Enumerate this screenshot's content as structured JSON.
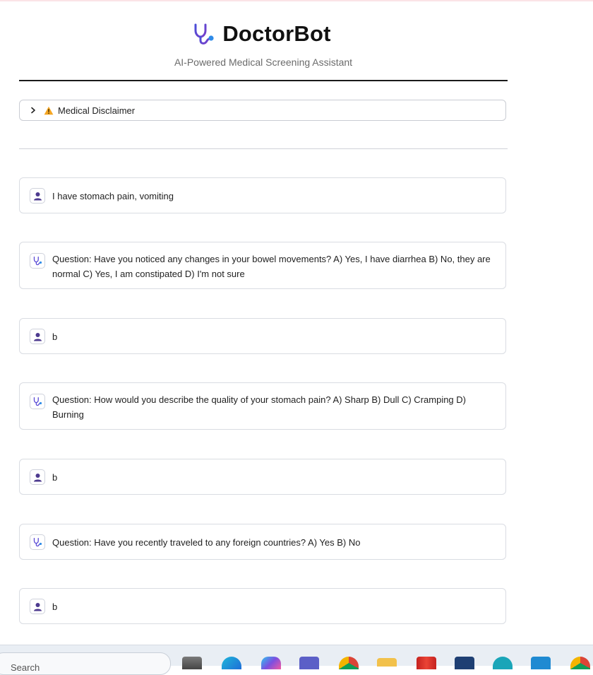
{
  "header": {
    "title": "DoctorBot",
    "subtitle": "AI-Powered Medical Screening Assistant",
    "logo_icon": "stethoscope-icon",
    "accent_color": "#5b4bd6"
  },
  "disclaimer": {
    "label": "Medical Disclaimer",
    "expand_icon": "chevron-right-icon",
    "warning_icon": "warning-icon"
  },
  "messages": [
    {
      "role": "user",
      "icon": "user-icon",
      "text": "I have stomach pain, vomiting"
    },
    {
      "role": "assistant",
      "icon": "stethoscope-icon",
      "text": "Question: Have you noticed any changes in your bowel movements? A) Yes, I have diarrhea B) No, they are normal C) Yes, I am constipated D) I'm not sure"
    },
    {
      "role": "user",
      "icon": "user-icon",
      "text": "b"
    },
    {
      "role": "assistant",
      "icon": "stethoscope-icon",
      "text": "Question: How would you describe the quality of your stomach pain? A) Sharp B) Dull C) Cramping D) Burning"
    },
    {
      "role": "user",
      "icon": "user-icon",
      "text": "b"
    },
    {
      "role": "assistant",
      "icon": "stethoscope-icon",
      "text": "Question: Have you recently traveled to any foreign countries? A) Yes B) No"
    },
    {
      "role": "user",
      "icon": "user-icon",
      "text": "b"
    }
  ],
  "taskbar": {
    "search_text": "Search",
    "apps": [
      "task-view-icon",
      "edge-icon",
      "copilot-icon",
      "teams-icon",
      "chrome-icon",
      "file-explorer-icon",
      "gmail-icon",
      "store-icon",
      "vpn-icon",
      "vscode-icon",
      "chrome-profile-icon"
    ]
  }
}
